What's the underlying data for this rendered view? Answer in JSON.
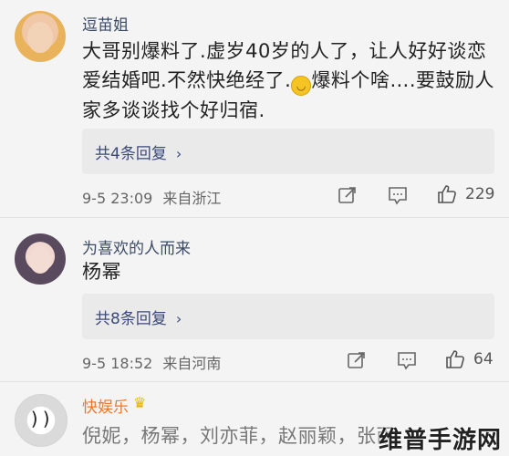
{
  "comments": [
    {
      "username": "逗苗姐",
      "content_a": "大哥别爆料了.虚岁40岁的人了，让人好好谈恋爱结婚吧.不然快绝经了.",
      "content_b": "爆料个啥….要鼓励人家多谈谈找个好归宿.",
      "replies_label": "共4条回复",
      "date": "9-5 23:09",
      "location": "来自浙江",
      "likes": "229"
    },
    {
      "username": "为喜欢的人而来",
      "content": "杨幂",
      "replies_label": "共8条回复",
      "date": "9-5 18:52",
      "location": "来自河南",
      "likes": "64"
    },
    {
      "username": "快娱乐",
      "content": "倪妮，杨幂，刘亦菲，赵丽颖，张雨绮",
      "avatar_text": "))"
    }
  ],
  "watermark": "维普手游网",
  "icons": {
    "reply_chevron": "chevron-right-icon",
    "share": "share-icon",
    "comment": "comment-icon",
    "like": "thumbs-up-icon",
    "crown": "crown-icon"
  },
  "colors": {
    "username": "#3b4a66",
    "verified_username": "#e9782e",
    "reply_link": "#3b4a7a",
    "background": "#f4f4f4"
  }
}
